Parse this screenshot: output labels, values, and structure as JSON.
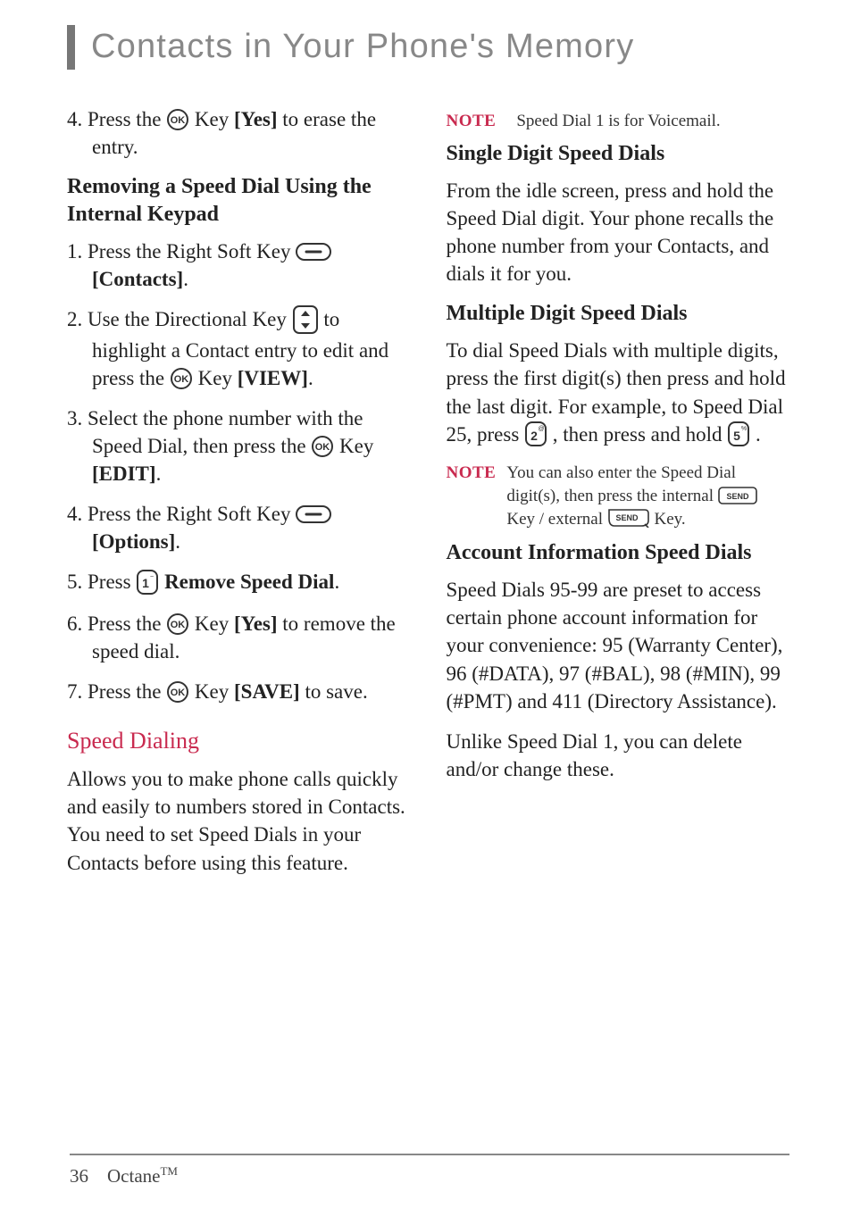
{
  "title": "Contacts in Your Phone's Memory",
  "left": {
    "step4a_a": "4. Press the ",
    "step4a_b": " Key ",
    "step4a_yes": "[Yes]",
    "step4a_c": " to erase the entry.",
    "subhead1": "Removing a Speed Dial Using the Internal Keypad",
    "s1_a": "1. Press the Right Soft Key ",
    "s1_contacts": "[Contacts]",
    "s1_b": ".",
    "s2_a": "2. Use the Directional Key ",
    "s2_b": " to highlight a Contact entry to edit and press the ",
    "s2_c": " Key ",
    "s2_view": "[VIEW]",
    "s2_d": ".",
    "s3_a": "3. Select the phone number with the Speed Dial, then press the ",
    "s3_b": " Key ",
    "s3_edit": "[EDIT]",
    "s3_c": ".",
    "s4_a": "4. Press the Right Soft Key ",
    "s4_options": "[Options]",
    "s4_b": ".",
    "s5_a": "5. Press ",
    "s5_remove": "Remove Speed Dial",
    "s5_b": ".",
    "s6_a": "6. Press the ",
    "s6_b": " Key ",
    "s6_yes": "[Yes]",
    "s6_c": " to remove the speed dial.",
    "s7_a": "7. Press the ",
    "s7_b": " Key ",
    "s7_save": "[SAVE]",
    "s7_c": " to save.",
    "speed_dialing": "Speed Dialing",
    "sd_para": "Allows you to make phone calls quickly and easily to numbers stored in Contacts. You need to set Speed Dials in your Contacts before using this feature."
  },
  "right": {
    "note1_label": "NOTE",
    "note1_text": "Speed Dial 1 is for Voicemail.",
    "single_head": "Single Digit Speed Dials",
    "single_para": "From the idle screen, press and hold the Speed Dial digit. Your phone recalls the phone number from your Contacts, and dials it for you.",
    "multi_head": "Multiple Digit Speed Dials",
    "multi_a": "To dial Speed Dials with multiple digits, press the first digit(s) then press and hold the last digit. For example, to Speed Dial 25, press ",
    "multi_b": ", then press and hold ",
    "multi_c": ".",
    "note2_label": "NOTE",
    "note2_a": "You can also enter the Speed Dial digit(s), then press the internal ",
    "note2_b": " Key / external ",
    "note2_c": " Key.",
    "acct_head": "Account Information Speed Dials",
    "acct_para": "Speed Dials 95-99 are preset to access certain phone account information for your convenience: 95 (Warranty Center), 96 (#DATA), 97 (#BAL), 98 (#MIN), 99 (#PMT) and 411 (Directory Assistance).",
    "acct_para2": "Unlike Speed Dial 1, you can delete and/or change these."
  },
  "footer": {
    "page": "36",
    "product": "Octane",
    "tm": "TM"
  }
}
